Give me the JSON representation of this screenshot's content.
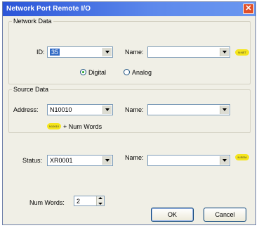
{
  "window": {
    "title": "Network Port Remote I/O",
    "close_glyph": "✕"
  },
  "network_data": {
    "group_label": "Network Data",
    "id_label": "ID:",
    "id_value": "35",
    "name_label": "Name:",
    "name_value": "",
    "bubble_text": "N:NET",
    "radio_digital": "Digital",
    "radio_analog": "Analog",
    "selected_mode": "Digital"
  },
  "source_data": {
    "group_label": "Source Data",
    "address_label": "Address:",
    "address_value": "N10010",
    "name_label": "Name:",
    "name_value": "",
    "bubble_text": "N10010",
    "bubble_suffix": "+ Num Words"
  },
  "status": {
    "label": "Status:",
    "value": "XR0001",
    "name_label": "Name:",
    "name_value": "",
    "bubble_text": "N:REM"
  },
  "num_words": {
    "label": "Num Words:",
    "value": "2"
  },
  "buttons": {
    "ok": "OK",
    "cancel": "Cancel"
  },
  "colors": {
    "titlebar": "#2b55d8",
    "highlight_bubble": "#f5e51c",
    "dialog_bg": "#f0efe6"
  }
}
